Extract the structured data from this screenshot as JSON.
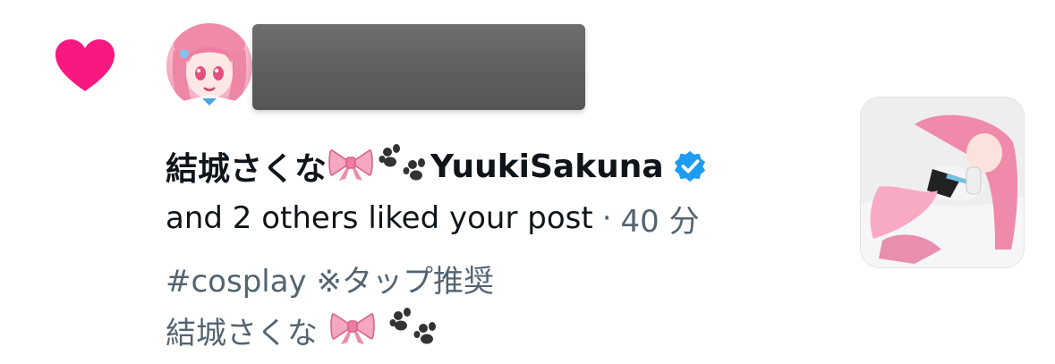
{
  "notification": {
    "type": "like",
    "colors": {
      "heart": "#f91880",
      "verified": "#1d9bf0",
      "primary_text": "#0f1419",
      "secondary_text": "#536471"
    },
    "actor": {
      "display_name": "結城さくな",
      "handle_text": "YuukiSakuna",
      "emojis": [
        "ribbon-emoji",
        "paw-prints-emoji"
      ],
      "verified": true
    },
    "action_text": "and 2 others liked your post",
    "separator": "·",
    "time": "40 分",
    "post_preview": {
      "line1": "#cosplay ※タップ推奨",
      "line2": "結城さくな"
    },
    "thumbnail": "post-thumbnail-image"
  }
}
